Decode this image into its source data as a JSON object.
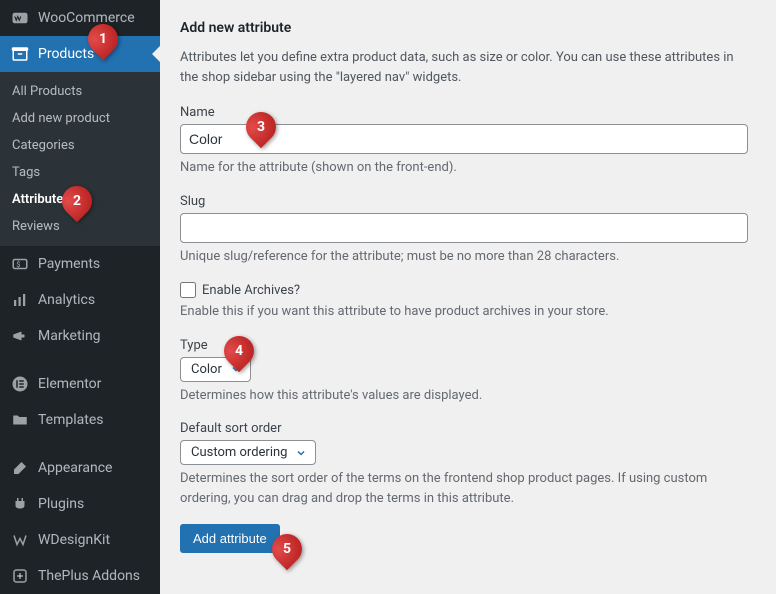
{
  "sidebar": {
    "woocommerce": "WooCommerce",
    "products": "Products",
    "sub": {
      "all": "All Products",
      "add": "Add new product",
      "categories": "Categories",
      "tags": "Tags",
      "attributes": "Attributes",
      "reviews": "Reviews"
    },
    "payments": "Payments",
    "analytics": "Analytics",
    "marketing": "Marketing",
    "elementor": "Elementor",
    "templates": "Templates",
    "appearance": "Appearance",
    "plugins": "Plugins",
    "wdesignkit": "WDesignKit",
    "theplus": "ThePlus Addons"
  },
  "page": {
    "title": "Add new attribute",
    "intro": "Attributes let you define extra product data, such as size or color. You can use these attributes in the shop sidebar using the \"layered nav\" widgets.",
    "name_label": "Name",
    "name_value": "Color",
    "name_help": "Name for the attribute (shown on the front-end).",
    "slug_label": "Slug",
    "slug_value": "",
    "slug_help": "Unique slug/reference for the attribute; must be no more than 28 characters.",
    "archives_label": "Enable Archives?",
    "archives_help": "Enable this if you want this attribute to have product archives in your store.",
    "type_label": "Type",
    "type_value": "Color",
    "type_help": "Determines how this attribute's values are displayed.",
    "sort_label": "Default sort order",
    "sort_value": "Custom ordering",
    "sort_help": "Determines the sort order of the terms on the frontend shop product pages. If using custom ordering, you can drag and drop the terms in this attribute.",
    "submit": "Add attribute"
  },
  "markers": {
    "m1": "1",
    "m2": "2",
    "m3": "3",
    "m4": "4",
    "m5": "5"
  }
}
